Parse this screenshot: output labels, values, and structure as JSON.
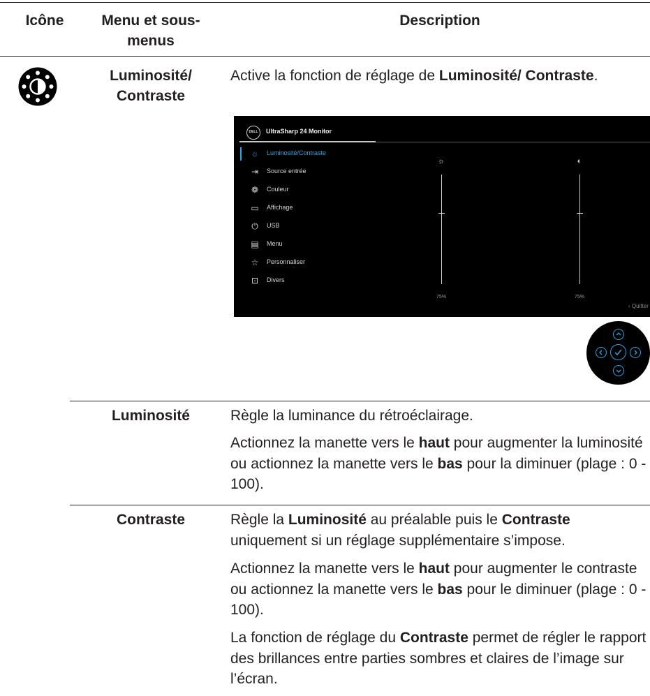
{
  "table": {
    "headers": {
      "icon": "Icône",
      "menu": "Menu et sous-menus",
      "description": "Description"
    },
    "main_row": {
      "menu": "Luminosité/ Contraste",
      "description_pre": "Active la fonction de réglage de ",
      "description_bold": "Luminosité/ Contraste",
      "description_post": "."
    },
    "rows": [
      {
        "menu": "Luminosité",
        "paragraphs": [
          {
            "pre": "Règle la luminance du rétroéclairage."
          },
          {
            "pre": "Actionnez la manette vers le ",
            "b1": "haut",
            "mid": " pour augmenter la luminosité ou actionnez la manette vers le ",
            "b2": "bas",
            "post": " pour la diminuer (plage : 0 - 100)."
          }
        ]
      },
      {
        "menu": "Contraste",
        "paragraphs": [
          {
            "pre": "Règle la ",
            "b1": "Luminosité",
            "mid": " au préalable puis le ",
            "b2": "Contraste",
            "post": " uniquement si un réglage supplémentaire s’impose."
          },
          {
            "pre": "Actionnez la manette vers le ",
            "b1": "haut",
            "mid": " pour augmenter le contraste ou actionnez la manette vers le ",
            "b2": "bas",
            "post": " pour le diminuer (plage : 0 - 100)."
          },
          {
            "pre": "La fonction de réglage du ",
            "b1": "Contraste",
            "post": " permet de régler le rapport des brillances entre parties sombres et claires de l’image sur l’écran."
          }
        ]
      }
    ]
  },
  "osd": {
    "logo": "DELL",
    "title": "UltraSharp 24 Monitor",
    "items": [
      {
        "label": "Luminosité/Contraste",
        "icon": "sun-icon",
        "active": true
      },
      {
        "label": "Source entrée",
        "icon": "input-source-icon"
      },
      {
        "label": "Couleur",
        "icon": "palette-icon"
      },
      {
        "label": "Affichage",
        "icon": "display-icon"
      },
      {
        "label": "USB",
        "icon": "usb-icon"
      },
      {
        "label": "Menu",
        "icon": "menu-icon"
      },
      {
        "label": "Personnaliser",
        "icon": "star-icon"
      },
      {
        "label": "Divers",
        "icon": "info-icon"
      }
    ],
    "brightness_value": "75%",
    "contrast_value": "75%",
    "brightness_level": 0.75,
    "contrast_level": 0.75,
    "quit_label": "‹ Quitter",
    "accent_color": "#2ea3e6"
  },
  "joystick": {
    "buttons": [
      "up-icon",
      "left-icon",
      "check-icon",
      "right-icon",
      "down-icon"
    ]
  }
}
